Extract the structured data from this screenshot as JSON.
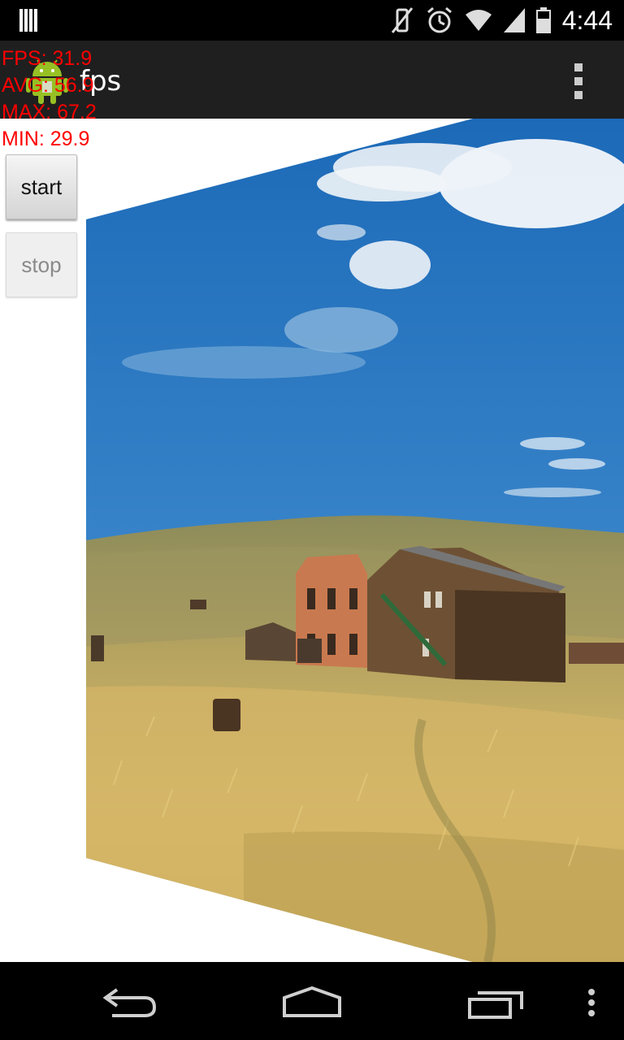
{
  "status_bar": {
    "time": "4:44",
    "icons": [
      "notification-bars-icon",
      "vibrate-icon",
      "alarm-icon",
      "wifi-icon",
      "signal-icon",
      "battery-icon"
    ]
  },
  "action_bar": {
    "title": "fps",
    "app_icon": "android-icon",
    "menu_icon": "overflow-menu-icon"
  },
  "fps": {
    "fps_line": "FPS: 31.9",
    "avg_line": "AVG: 56.9",
    "max_line": "MAX: 67.2",
    "min_line": "MIN: 29.9"
  },
  "buttons": {
    "start_label": "start",
    "stop_label": "stop"
  },
  "photo": {
    "description_icon": "ghost-town-landscape-image"
  },
  "nav_bar": {
    "icons": [
      "back-icon",
      "home-icon",
      "recents-icon",
      "menu-icon"
    ]
  },
  "colors": {
    "fps_text": "#ff0000",
    "action_bar": "#1f1f1f",
    "sky": "#2f7ac4"
  }
}
